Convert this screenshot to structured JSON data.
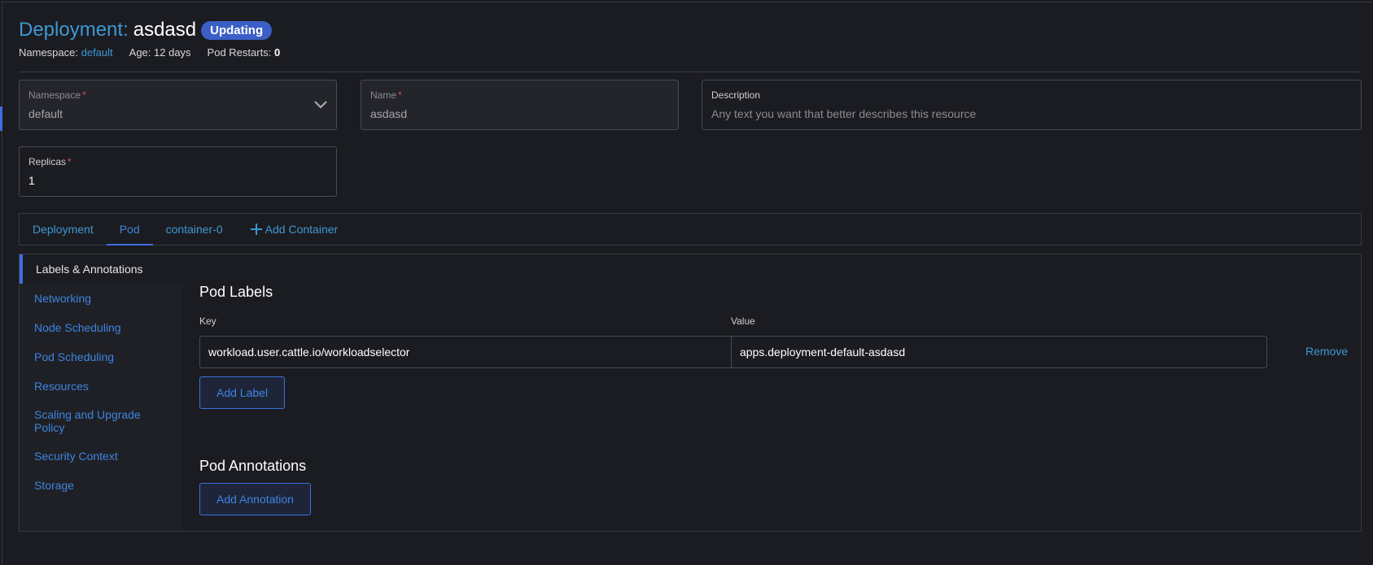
{
  "header": {
    "title_prefix": "Deployment:",
    "title_name": "asdasd",
    "status_badge": "Updating",
    "namespace_label": "Namespace:",
    "namespace_value": "default",
    "age": "Age: 12 days",
    "restarts_label": "Pod Restarts:",
    "restarts_value": "0"
  },
  "form": {
    "namespace": {
      "label": "Namespace",
      "value": "default"
    },
    "name": {
      "label": "Name",
      "value": "asdasd"
    },
    "description": {
      "label": "Description",
      "placeholder": "Any text you want that better describes this resource"
    },
    "replicas": {
      "label": "Replicas",
      "value": "1"
    },
    "required_mark": "*"
  },
  "tabs": [
    {
      "label": "Deployment"
    },
    {
      "label": "Pod",
      "active": true
    },
    {
      "label": "container-0"
    },
    {
      "label": "Add Container"
    }
  ],
  "side_nav": [
    {
      "label": "Labels & Annotations",
      "active": true
    },
    {
      "label": "Networking"
    },
    {
      "label": "Node Scheduling"
    },
    {
      "label": "Pod Scheduling"
    },
    {
      "label": "Resources"
    },
    {
      "label": "Scaling and Upgrade Policy"
    },
    {
      "label": "Security Context"
    },
    {
      "label": "Storage"
    }
  ],
  "pod_labels": {
    "title": "Pod Labels",
    "key_header": "Key",
    "value_header": "Value",
    "rows": [
      {
        "key": "workload.user.cattle.io/workloadselector",
        "value": "apps.deployment-default-asdasd",
        "remove": "Remove"
      }
    ],
    "add_button": "Add Label"
  },
  "pod_annotations": {
    "title": "Pod Annotations",
    "add_button": "Add Annotation"
  },
  "icons": {
    "namespace_dropdown": "chevron-down-icon",
    "add_container": "plus-icon"
  },
  "colors": {
    "accent": "#3d6fe0",
    "link": "#3d98d3",
    "badge": "#3b5fc7",
    "required": "#e04a4a",
    "background": "#1b1c21"
  }
}
